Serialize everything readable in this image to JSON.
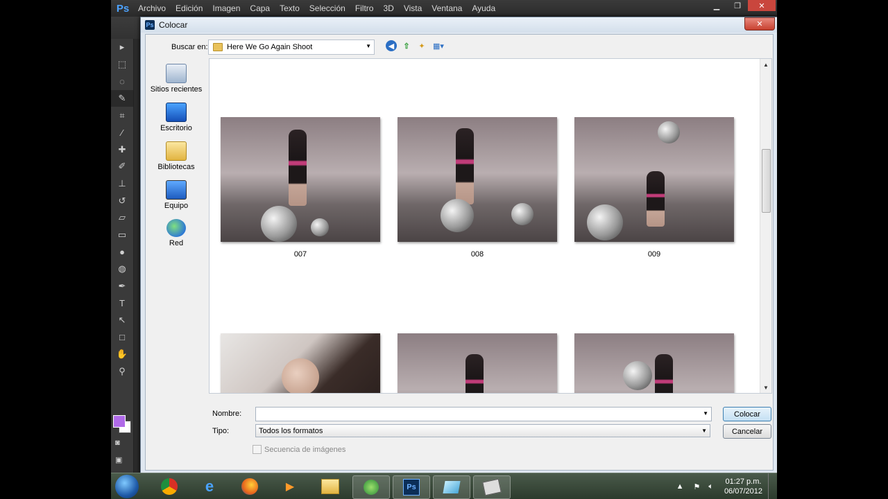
{
  "menubar": {
    "logo": "Ps",
    "items": [
      "Archivo",
      "Edición",
      "Imagen",
      "Capa",
      "Texto",
      "Selección",
      "Filtro",
      "3D",
      "Vista",
      "Ventana",
      "Ayuda"
    ],
    "win_controls": {
      "minimize": "▁",
      "restore": "❐",
      "close": "✕"
    }
  },
  "dialog": {
    "title": "Colocar",
    "close": "✕",
    "look_in_label": "Buscar en:",
    "look_in_value": "Here We Go Again Shoot",
    "places": [
      "Sitios recientes",
      "Escritorio",
      "Bibliotecas",
      "Equipo",
      "Red"
    ],
    "files": [
      {
        "label": "007"
      },
      {
        "label": "008"
      },
      {
        "label": "009"
      },
      {
        "label": ""
      },
      {
        "label": ""
      },
      {
        "label": ""
      }
    ],
    "name_label": "Nombre:",
    "name_value": "",
    "type_label": "Tipo:",
    "type_value": "Todos los formatos",
    "place_button": "Colocar",
    "cancel_button": "Cancelar",
    "sequence_label": "Secuencia de imágenes"
  },
  "taskbar": {
    "time": "01:27 p.m.",
    "date": "06/07/2012"
  }
}
